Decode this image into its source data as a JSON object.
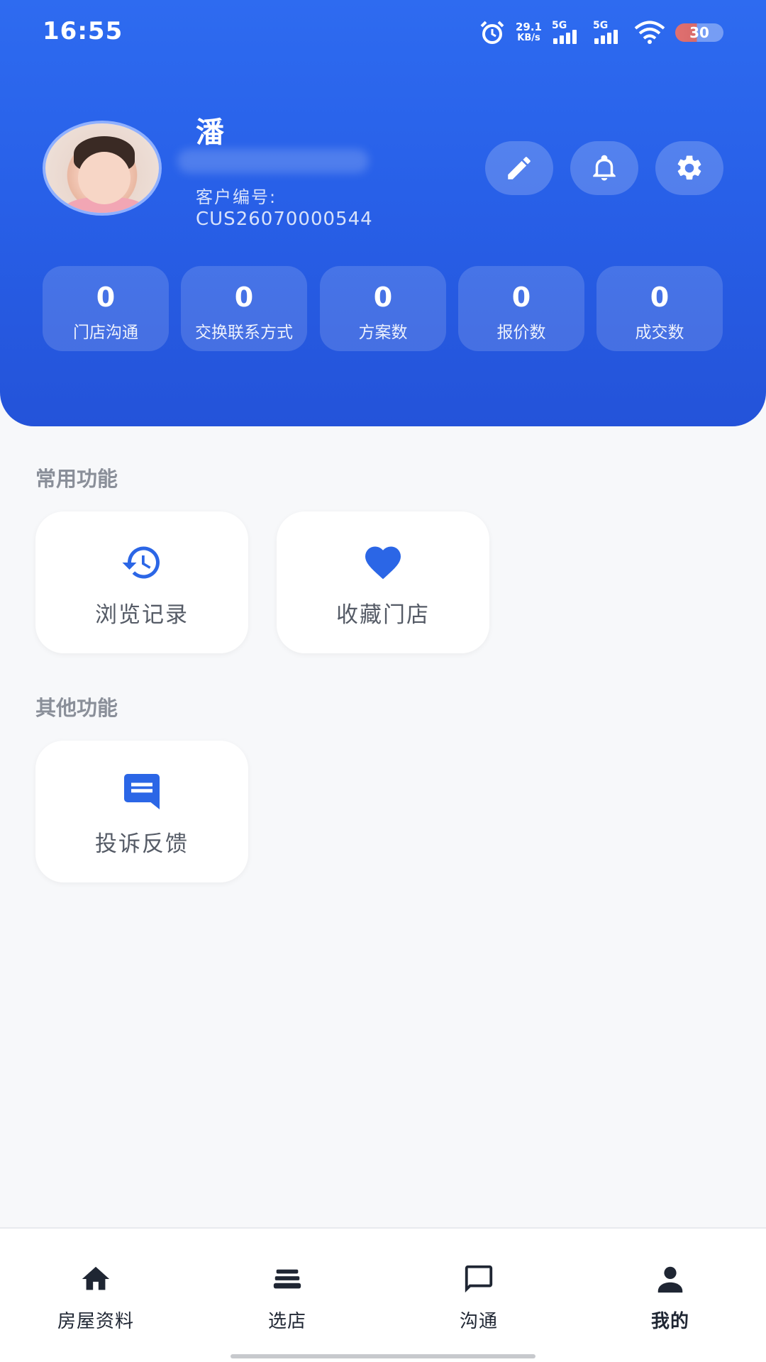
{
  "status_bar": {
    "time": "16:55",
    "net_speed_value": "29.1",
    "net_speed_unit": "KB/s",
    "signal_1_label": "5G",
    "signal_2_label": "5G",
    "battery": "30",
    "icons": [
      "alarm-icon",
      "signal-icon",
      "wifi-icon",
      "battery-icon"
    ]
  },
  "profile": {
    "name": "潘",
    "customer_label": "客户编号:",
    "customer_id": "CUS26070000544"
  },
  "header_actions": [
    "edit-icon",
    "bell-icon",
    "settings-icon"
  ],
  "stats": [
    {
      "value": "0",
      "label": "门店沟通"
    },
    {
      "value": "0",
      "label": "交换联系方式"
    },
    {
      "value": "0",
      "label": "方案数"
    },
    {
      "value": "0",
      "label": "报价数"
    },
    {
      "value": "0",
      "label": "成交数"
    }
  ],
  "sections": {
    "common_title": "常用功能",
    "common_items": [
      {
        "label": "浏览记录",
        "icon": "history-icon"
      },
      {
        "label": "收藏门店",
        "icon": "heart-icon"
      }
    ],
    "other_title": "其他功能",
    "other_items": [
      {
        "label": "投诉反馈",
        "icon": "feedback-icon"
      }
    ]
  },
  "bottom_nav": [
    {
      "label": "房屋资料",
      "icon": "home-icon"
    },
    {
      "label": "选店",
      "icon": "stack-icon"
    },
    {
      "label": "沟通",
      "icon": "chat-icon"
    },
    {
      "label": "我的",
      "icon": "person-icon",
      "active": true
    }
  ],
  "colors": {
    "primary": "#2b66e6",
    "header_bg": "#2860e8",
    "page_bg": "#f7f8fa"
  }
}
